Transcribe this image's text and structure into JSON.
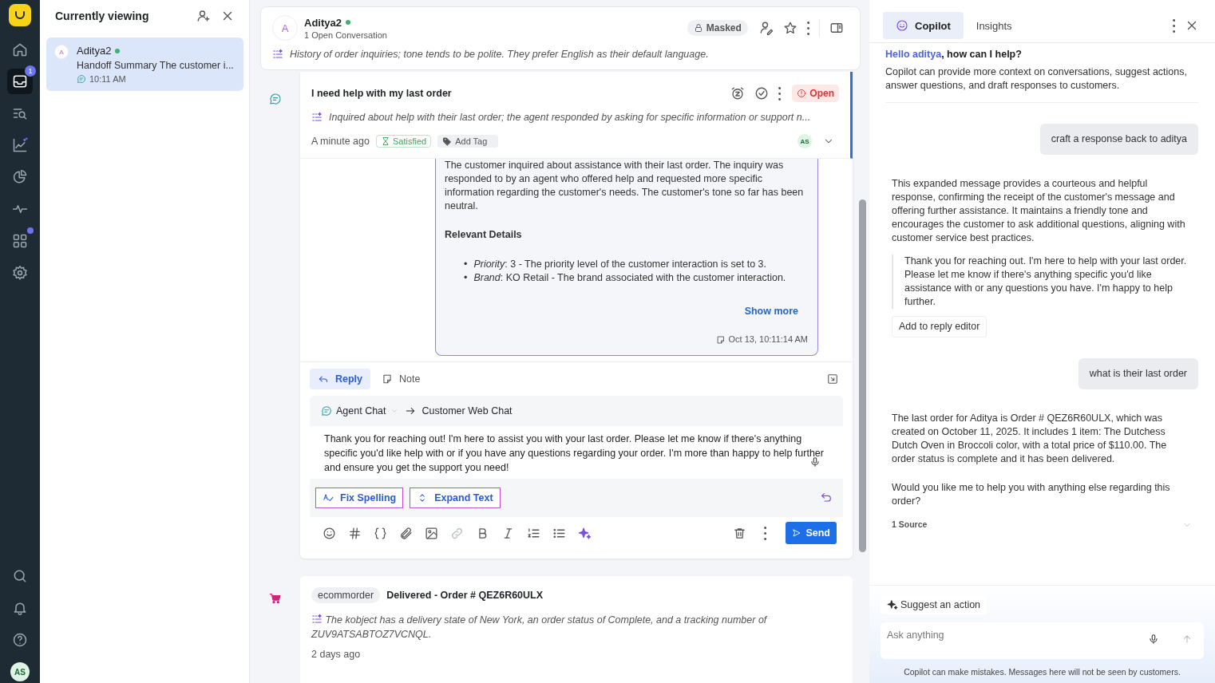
{
  "rail": {
    "items": [
      {
        "selected": false,
        "dot": false
      },
      {
        "selected": true,
        "dot": false,
        "badge": "1"
      },
      {
        "selected": false,
        "dot": false
      },
      {
        "selected": false,
        "dot": false
      },
      {
        "selected": false,
        "dot": false
      },
      {
        "selected": false,
        "dot": false
      },
      {
        "selected": false,
        "dot": true
      },
      {
        "selected": false,
        "dot": false
      }
    ],
    "avatar": "AS"
  },
  "viewing": {
    "title": "Currently viewing",
    "items": [
      {
        "avatar": "A",
        "name": "Aditya2",
        "online": true,
        "preview": "Handoff Summary The customer i...",
        "time": "10:11 AM",
        "selected": true
      }
    ]
  },
  "contact": {
    "avatar": "A",
    "name": "Aditya2",
    "online": true,
    "subtitle": "1 Open Conversation",
    "masked": "Masked",
    "summary": "History of order inquiries; tone tends to be polite. They prefer English as their default language."
  },
  "conversation": {
    "title": "I need help with my last order",
    "status": "Open",
    "summary": "Inquired about help with their last order; the agent responded by asking for specific information or support n...",
    "time": "A minute ago",
    "sentiment": "Satisfied",
    "add_tag": "Add Tag",
    "assignee": "AS"
  },
  "handoff": {
    "bullet": "•",
    "paragraph": "The customer inquired about assistance with their last order. The inquiry was responded to by an agent who offered help and requested more specific information regarding the customer's needs. The customer's tone so far has been neutral.",
    "heading": "Relevant Details",
    "details": [
      "*Priority*: 3 - The priority level of the customer interaction is set to 3.",
      "*Brand*: KO Retail - The brand associated with the customer interaction."
    ],
    "show_more": "Show more",
    "timestamp": "Oct 13, 10:11:14 AM"
  },
  "composer": {
    "tabs": [
      {
        "label": "Reply",
        "selected": true
      },
      {
        "label": "Note",
        "selected": false
      }
    ],
    "from": "Agent Chat",
    "to": "Customer Web Chat",
    "value": "Thank you for reaching out! I'm here to assist you with your last order. Please let me know if there's anything specific you'd like help with or if you have any questions regarding your order. I'm more than happy to help further and ensure you get the support you need!",
    "ai_actions": [
      "Fix Spelling",
      "Expand Text"
    ],
    "send": "Send"
  },
  "order_event": {
    "tag": "ecommorder",
    "title": "Delivered - Order # QEZ6R60ULX",
    "summary": "The kobject has a delivery state of New York, an order status of Complete, and a tracking number of ZUV9ATSABTOZ7VCNQL.",
    "time": "2 days ago"
  },
  "copilot": {
    "tabs": [
      {
        "label": "Copilot",
        "selected": true
      },
      {
        "label": "Insights",
        "selected": false
      }
    ],
    "greeting": {
      "name": "Hello aditya",
      "rest": ", how can I help?"
    },
    "intro": "Copilot can provide more context on conversations, suggest actions, answer questions, and draft responses to customers.",
    "messages": [
      {
        "kind": "user",
        "text": "craft a response back to aditya"
      },
      {
        "kind": "assistant",
        "paragraphs": [
          "This expanded message provides a courteous and helpful response, confirming the receipt of the customer's message and offering further assistance. It maintains a friendly tone and encourages the customer to ask additional questions, aligning with customer service best practices."
        ],
        "quote": "Thank you for reaching out. I'm here to help with your last order. Please let me know if there's anything specific you'd like assistance with or any questions you have. I'm happy to help further.",
        "action": "Add to reply editor"
      },
      {
        "kind": "user",
        "text": "what is their last order"
      },
      {
        "kind": "assistant",
        "paragraphs": [
          "The last order for Aditya is Order # QEZ6R60ULX, which was created on October 11, 2025. It includes 1 item: The Dutchess Dutch Oven in Broccoli color, with a total price of $110.00. The order status is complete and it has been delivered.",
          "Would you like me to help you with anything else regarding this order?"
        ],
        "sources": "1 Source"
      }
    ],
    "suggest": "Suggest an action",
    "input": {
      "placeholder": "Ask anything"
    },
    "disclaimer": "Copilot can make mistakes. Messages here will not be seen by customers."
  }
}
